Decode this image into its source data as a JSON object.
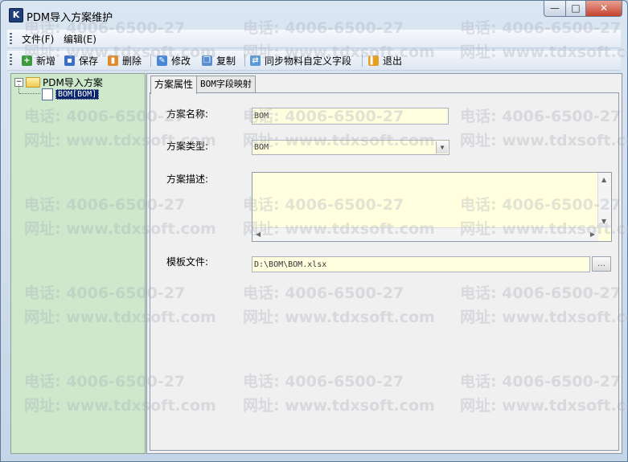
{
  "window": {
    "title": "PDM导入方案维护",
    "buttons": {
      "minimize": "—",
      "maximize": "□",
      "close": "✕"
    }
  },
  "menu": {
    "file": "文件(F)",
    "edit": "编辑(E)"
  },
  "toolbar": {
    "new": "新增",
    "save": "保存",
    "delete": "删除",
    "modify": "修改",
    "copy": "复制",
    "sync": "同步物料自定义字段",
    "exit": "退出"
  },
  "tree": {
    "root": "PDM导入方案",
    "child": "BOM[BOM]",
    "expander": "−"
  },
  "tabs": {
    "props": "方案属性",
    "mapping": "BOM字段映射"
  },
  "form": {
    "name_label": "方案名称:",
    "name_value": "BOM",
    "type_label": "方案类型:",
    "type_value": "BOM",
    "desc_label": "方案描述:",
    "desc_value": "",
    "template_label": "模板文件:",
    "template_value": "D:\\BOM\\BOM.xlsx"
  },
  "watermark": {
    "phone": "电话: 4006-6500-27",
    "site": "网址: www.tdxsoft.com"
  },
  "colors": {
    "tree_bg": "#cde8cb",
    "field_bg": "#ffffe0",
    "selection": "#0a246a",
    "close_btn": "#c4432c"
  }
}
